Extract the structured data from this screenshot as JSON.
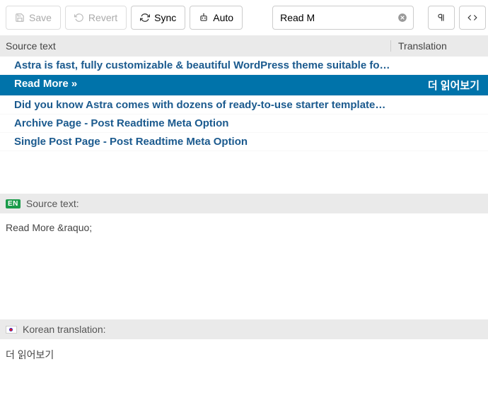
{
  "toolbar": {
    "save_label": "Save",
    "revert_label": "Revert",
    "sync_label": "Sync",
    "auto_label": "Auto"
  },
  "search": {
    "value": "Read M"
  },
  "columns": {
    "source": "Source text",
    "translation": "Translation"
  },
  "rows": [
    {
      "source": "Astra is fast, fully customizable & beautiful WordPress theme suitable for …",
      "translation": "",
      "selected": false
    },
    {
      "source": "Read More »",
      "translation": "더 읽어보기",
      "selected": true
    },
    {
      "source": "Did you know Astra comes with dozens of ready-to-use starter templates? I…",
      "translation": "",
      "selected": false
    },
    {
      "source": "Archive Page - Post Readtime Meta Option",
      "translation": "",
      "selected": false
    },
    {
      "source": "Single Post Page - Post Readtime Meta Option",
      "translation": "",
      "selected": false
    }
  ],
  "source_panel": {
    "badge": "EN",
    "label": "Source text:",
    "value": "Read More &raquo;"
  },
  "translation_panel": {
    "label": "Korean translation:",
    "value": "더 읽어보기"
  }
}
